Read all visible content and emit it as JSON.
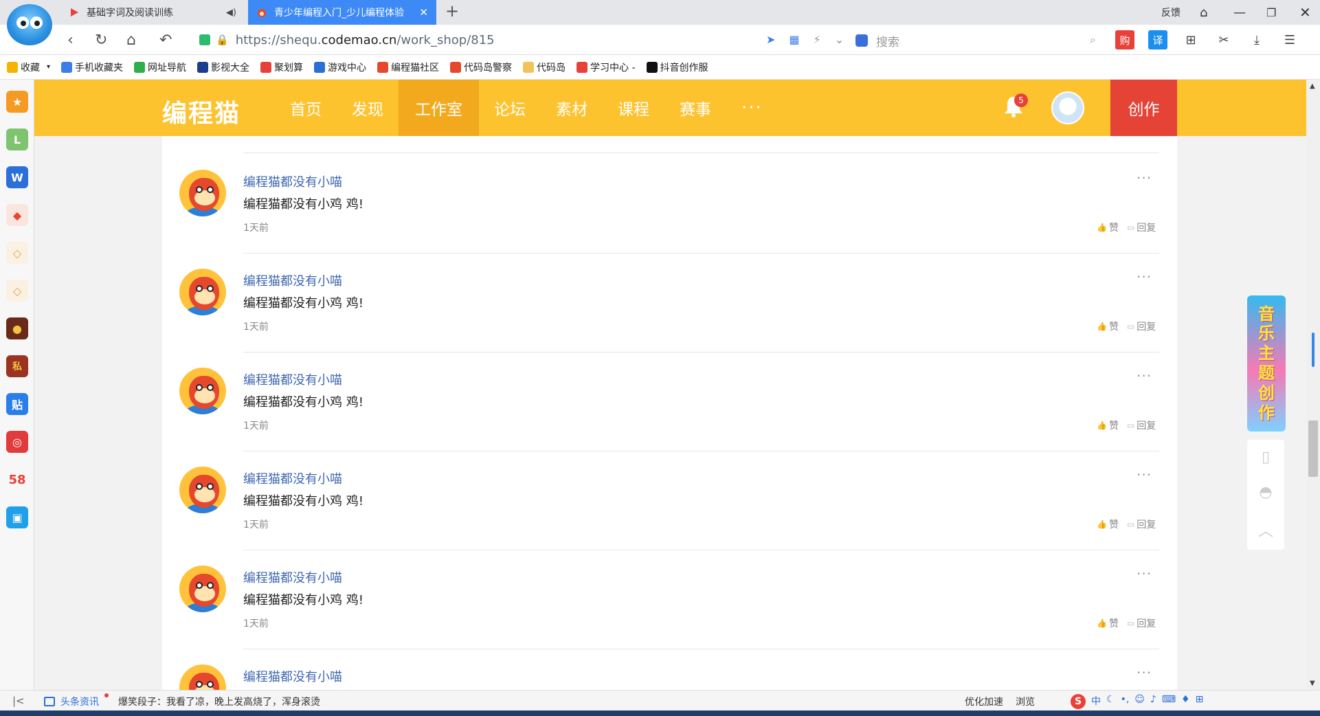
{
  "browser": {
    "tabs": [
      {
        "label": "基础字词及阅读训练",
        "active": false
      },
      {
        "label": "青少年编程入门_少儿编程体验",
        "active": true
      }
    ],
    "feedback_label": "反馈",
    "url": {
      "scheme": "https://",
      "subdomain": "shequ.",
      "host": "codemao.cn",
      "path": "/work_shop/815"
    },
    "search_placeholder": "搜索",
    "buy_label": "购",
    "translate_label": "译"
  },
  "bookmarks": [
    {
      "label": "收藏",
      "color": "#f5b400"
    },
    {
      "label": "手机收藏夹",
      "color": "#3b7ee8"
    },
    {
      "label": "网址导航",
      "color": "#2fae4b"
    },
    {
      "label": "影视大全",
      "color": "#1b3e8c"
    },
    {
      "label": "聚划算",
      "color": "#e8413a"
    },
    {
      "label": "游戏中心",
      "color": "#2a6fd6"
    },
    {
      "label": "编程猫社区",
      "color": "#e5482d"
    },
    {
      "label": "代码岛警察",
      "color": "#e5482d"
    },
    {
      "label": "代码岛",
      "color": "#f1c35a"
    },
    {
      "label": "学习中心 -",
      "color": "#e8413a"
    },
    {
      "label": "抖音创作服",
      "color": "#111111"
    }
  ],
  "leftbar": [
    {
      "name": "favorites-app-icon",
      "glyph": "★",
      "color": "#f59a23"
    },
    {
      "name": "history-app-icon",
      "glyph": "L",
      "color": "#7fc36e"
    },
    {
      "name": "word-app-icon",
      "glyph": "W",
      "color": "#2b6fd8"
    },
    {
      "name": "codemao-app-icon",
      "glyph": "◆",
      "color": "#e5482d"
    },
    {
      "name": "box-app-icon",
      "glyph": "◇",
      "color": "#d8a354"
    },
    {
      "name": "box2-app-icon",
      "glyph": "◇",
      "color": "#d8a354"
    },
    {
      "name": "game-app-icon",
      "glyph": "●",
      "color": "#6a2a1a"
    },
    {
      "name": "game2-app-icon",
      "glyph": "私",
      "color": "#9a3322"
    },
    {
      "name": "tieba-app-icon",
      "glyph": "贴",
      "color": "#2b7de9"
    },
    {
      "name": "music-app-icon",
      "glyph": "◎",
      "color": "#e13b3b"
    },
    {
      "name": "58-app-icon",
      "glyph": "58",
      "color": "#f7f7f7"
    },
    {
      "name": "bilibili-app-icon",
      "glyph": "▣",
      "color": "#1fa0e8"
    }
  ],
  "site": {
    "logo": "编程猫",
    "nav": [
      "首页",
      "发现",
      "工作室",
      "论坛",
      "素材",
      "课程",
      "赛事"
    ],
    "nav_more": "···",
    "active_nav": "工作室",
    "notification_count": "5",
    "create_label": "创作",
    "brand_color": "#fdc32e"
  },
  "comments": [
    {
      "user": "编程猫都没有小喵",
      "text": "编程猫都没有小鸡 鸡!",
      "time": "1天前",
      "like": "赞",
      "reply": "回复"
    },
    {
      "user": "编程猫都没有小喵",
      "text": "编程猫都没有小鸡 鸡!",
      "time": "1天前",
      "like": "赞",
      "reply": "回复"
    },
    {
      "user": "编程猫都没有小喵",
      "text": "编程猫都没有小鸡 鸡!",
      "time": "1天前",
      "like": "赞",
      "reply": "回复"
    },
    {
      "user": "编程猫都没有小喵",
      "text": "编程猫都没有小鸡 鸡!",
      "time": "1天前",
      "like": "赞",
      "reply": "回复"
    },
    {
      "user": "编程猫都没有小喵",
      "text": "编程猫都没有小鸡 鸡!",
      "time": "1天前",
      "like": "赞",
      "reply": "回复"
    },
    {
      "user": "编程猫都没有小喵",
      "text": "",
      "time": "",
      "like": "",
      "reply": ""
    }
  ],
  "music_banner": [
    "音",
    "乐",
    "主",
    "题",
    "创",
    "作"
  ],
  "statusbar": {
    "news_label": "头条资讯",
    "ticker": "爆笑段子：我看了凉，晚上发高烧了，浑身滚烫",
    "speedup": "优化加速",
    "browse": "浏览",
    "ime_glyph": "S",
    "ime_mode": "中"
  }
}
